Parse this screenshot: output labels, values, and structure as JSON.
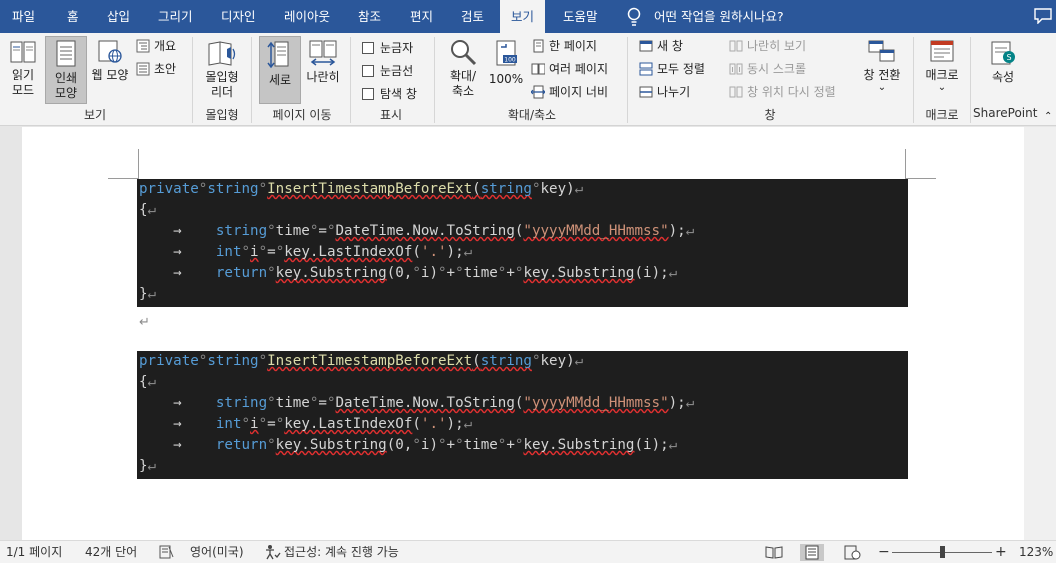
{
  "tabs": [
    "파일",
    "홈",
    "삽입",
    "그리기",
    "디자인",
    "레이아웃",
    "참조",
    "편지",
    "검토",
    "보기",
    "도움말"
  ],
  "active_tab": "보기",
  "tell_me": "어떤 작업을 원하시나요?",
  "ribbon": {
    "views": {
      "read_mode": "읽기\n모드",
      "print_layout": "인쇄\n모양",
      "web_layout": "웹 모양",
      "outline": "개요",
      "draft": "초안",
      "group": "보기"
    },
    "immersive": {
      "reader": "몰입형\n리더",
      "group": "몰입형"
    },
    "page_movement": {
      "vertical": "세로",
      "side_to_side": "나란히",
      "group": "페이지 이동"
    },
    "show": {
      "ruler": "눈금자",
      "gridlines": "눈금선",
      "navigation_pane": "탐색 창",
      "group": "표시"
    },
    "zoom": {
      "zoom": "확대/\n축소",
      "hundred": "100%",
      "one_page": "한 페이지",
      "multiple_pages": "여러 페이지",
      "page_width": "페이지 너비",
      "group": "확대/축소"
    },
    "window": {
      "new_window": "새 창",
      "arrange_all": "모두 정렬",
      "split": "나누기",
      "side_by_side": "나란히 보기",
      "sync_scroll": "동시 스크롤",
      "reset_position": "창 위치 다시 정렬",
      "switch_windows": "창 전환",
      "group": "창"
    },
    "macros": {
      "macros": "매크로",
      "group": "매크로"
    },
    "sharepoint": {
      "properties": "속성",
      "group": "SharePoint"
    }
  },
  "code_block": {
    "line1": {
      "kw1": "private",
      "kw2": "string",
      "fn": "InsertTimestampBeforeExt",
      "p1": "(",
      "kw3": "string",
      "arg": "key",
      "p2": ")"
    },
    "line2": "{",
    "line3": {
      "kw": "string",
      "var": "time",
      "eq": "=",
      "call": "DateTime.Now.ToString",
      "p1": "(",
      "str": "\"yyyyMMdd_HHmmss\"",
      "p2": ");"
    },
    "line4": {
      "kw": "int",
      "var": "i",
      "eq": "=",
      "call": "key.LastIndexOf",
      "p1": "(",
      "str": "'.'",
      "p2": ");"
    },
    "line5": {
      "kw": "return",
      "c1": "key.Substring",
      "a1": "(0,",
      "v1": "i",
      "a2": ")",
      "plus1": "+",
      "t": "time",
      "plus2": "+",
      "c2": "key.Substring",
      "a3": "(i);"
    },
    "line6": "}"
  },
  "status": {
    "page": "1/1 페이지",
    "words": "42개 단어",
    "language": "영어(미국)",
    "accessibility": "접근성: 계속 진행 가능",
    "zoom": "123%",
    "zoom_level_fraction": 0.5
  }
}
